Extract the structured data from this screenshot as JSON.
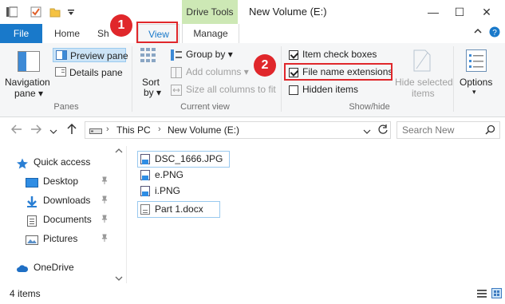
{
  "window": {
    "title": "New Volume (E:)",
    "context_tab_header": "Drive Tools",
    "minimize_glyph": "—",
    "maximize_glyph": "☐",
    "close_glyph": "✕"
  },
  "tabs": [
    {
      "label": "File"
    },
    {
      "label": "Home"
    },
    {
      "label": "Sh"
    },
    {
      "label": "View"
    },
    {
      "label": "Manage"
    }
  ],
  "ribbon": {
    "panes": {
      "navigation_pane": "Navigation",
      "navigation_pane_line2": "pane ▾",
      "preview_pane": "Preview pane",
      "details_pane": "Details pane",
      "group_label": "Panes"
    },
    "current_view": {
      "sort_by": "Sort",
      "sort_by_line2": "by ▾",
      "group_by": "Group by ▾",
      "add_columns": "Add columns ▾",
      "size_all_columns": "Size all columns to fit",
      "group_label": "Current view"
    },
    "show_hide": {
      "item_check_boxes": {
        "label": "Item check boxes",
        "checked": true
      },
      "file_name_extensions": {
        "label": "File name extensions",
        "checked": true
      },
      "hidden_items": {
        "label": "Hidden items",
        "checked": false
      },
      "hide_selected": "Hide selected",
      "hide_selected_line2": "items",
      "group_label": "Show/hide"
    },
    "options": {
      "label": "Options",
      "label_line2": "▾"
    }
  },
  "callouts": [
    {
      "number": "1"
    },
    {
      "number": "2"
    }
  ],
  "address": {
    "breadcrumb": [
      "This PC",
      "New Volume (E:)"
    ],
    "separator": "›",
    "search_placeholder": "Search New"
  },
  "nav": {
    "quick_access": "Quick access",
    "items": [
      {
        "label": "Desktop"
      },
      {
        "label": "Downloads"
      },
      {
        "label": "Documents"
      },
      {
        "label": "Pictures"
      }
    ],
    "onedrive": "OneDrive"
  },
  "files": [
    {
      "name": "DSC_1666.JPG",
      "type": "image"
    },
    {
      "name": "e.PNG",
      "type": "image"
    },
    {
      "name": "i.PNG",
      "type": "image"
    },
    {
      "name": "Part 1.docx",
      "type": "doc"
    }
  ],
  "status": {
    "item_count": "4 items"
  },
  "colors": {
    "accent": "#1979ca",
    "callout": "#e0272b",
    "context": "#cde8b5"
  }
}
